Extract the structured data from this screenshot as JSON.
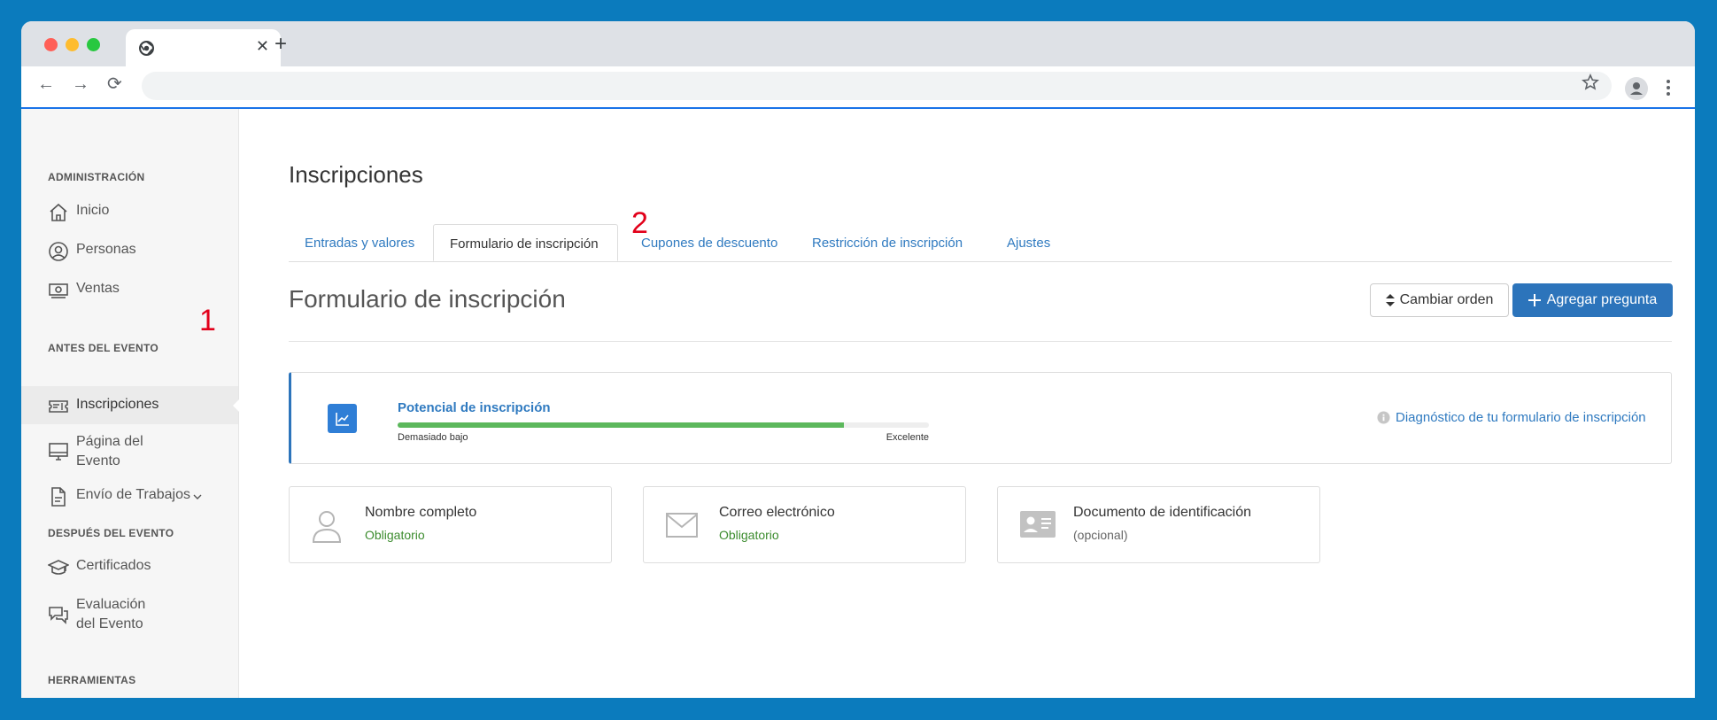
{
  "browser": {
    "colors": {
      "red": "#ff5f57",
      "yellow": "#febc2e",
      "green": "#28c840"
    }
  },
  "sidebar": {
    "sections": [
      {
        "title": "ADMINISTRACIÓN",
        "items": [
          {
            "label": "Inicio",
            "icon": "home-icon"
          },
          {
            "label": "Personas",
            "icon": "person-circle-icon"
          },
          {
            "label": "Ventas",
            "icon": "money-icon"
          }
        ]
      },
      {
        "title": "ANTES DEL EVENTO",
        "items": [
          {
            "label": "Inscripciones",
            "icon": "ticket-icon",
            "active": true
          },
          {
            "label_line1": "Página del",
            "label_line2": "Evento",
            "icon": "monitor-icon"
          },
          {
            "label": "Envío de Trabajos",
            "icon": "document-icon"
          }
        ]
      },
      {
        "title": "DESPUÉS DEL EVENTO",
        "items": [
          {
            "label": "Certificados",
            "icon": "graduation-cap-icon"
          },
          {
            "label_line1": "Evaluación",
            "label_line2": "del Evento",
            "icon": "chat-bubbles-icon"
          }
        ]
      },
      {
        "title": "HERRAMIENTAS",
        "items": []
      }
    ]
  },
  "markers": {
    "one": "1",
    "two": "2"
  },
  "main": {
    "title": "Inscripciones",
    "tabs": [
      {
        "label": "Entradas y valores"
      },
      {
        "label": "Formulario de inscripción",
        "active": true
      },
      {
        "label": "Cupones de descuento"
      },
      {
        "label": "Restricción de inscripción"
      },
      {
        "label": "Ajustes"
      }
    ],
    "section_title": "Formulario de inscripción",
    "buttons": {
      "order": "Cambiar orden",
      "add": "Agregar pregunta"
    },
    "potential": {
      "title": "Potencial de inscripción",
      "low_label": "Demasiado bajo",
      "high_label": "Excelente",
      "level_fraction": 0.84,
      "diagnostic_link": "Diagnóstico de tu formulario de inscripción"
    },
    "fields": [
      {
        "name": "Nombre completo",
        "status": "Obligatorio",
        "icon": "user-icon"
      },
      {
        "name": "Correo electrónico",
        "status": "Obligatorio",
        "icon": "envelope-icon"
      },
      {
        "name": "Documento de identificación",
        "status": "(opcional)",
        "icon": "id-card-icon"
      }
    ]
  }
}
